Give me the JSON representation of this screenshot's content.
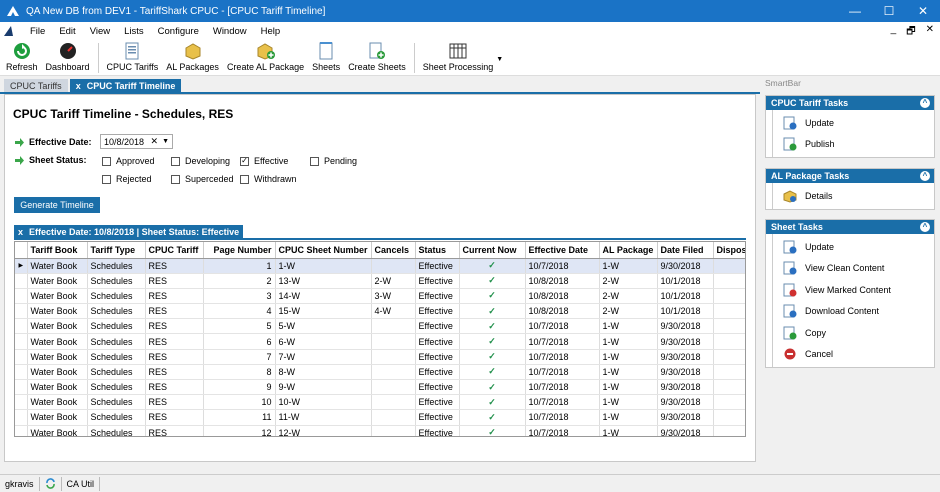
{
  "window": {
    "title": "QA New DB from DEV1 - TariffShark CPUC - [CPUC Tariff Timeline]",
    "controls": {
      "minimize": "—",
      "maximize": "☐",
      "close": "✕"
    },
    "mdi_controls": {
      "minimize": "_",
      "restore": "🗗",
      "close": "✕"
    }
  },
  "menu": [
    "File",
    "Edit",
    "View",
    "Lists",
    "Configure",
    "Window",
    "Help"
  ],
  "toolbar": {
    "refresh": "Refresh",
    "dashboard": "Dashboard",
    "cpuc_tariffs": "CPUC Tariffs",
    "al_packages": "AL Packages",
    "create_al_package": "Create AL Package",
    "sheets": "Sheets",
    "create_sheets": "Create Sheets",
    "sheet_processing": "Sheet Processing"
  },
  "tabs": [
    {
      "label": "CPUC Tariffs",
      "active": false
    },
    {
      "label": "CPUC Tariff Timeline",
      "active": true,
      "close": "x"
    }
  ],
  "main": {
    "title": "CPUC Tariff Timeline - Schedules, RES",
    "effective_date_label": "Effective Date:",
    "effective_date_value": "10/8/2018",
    "sheet_status_label": "Sheet Status:",
    "statuses": [
      {
        "label": "Approved",
        "checked": false
      },
      {
        "label": "Developing",
        "checked": false
      },
      {
        "label": "Effective",
        "checked": true
      },
      {
        "label": "Pending",
        "checked": false
      },
      {
        "label": "Rejected",
        "checked": false
      },
      {
        "label": "Superceded",
        "checked": false
      },
      {
        "label": "Withdrawn",
        "checked": false
      }
    ],
    "generate_button": "Generate Timeline",
    "grid_caption": "Effective Date: 10/8/2018 | Sheet Status: Effective",
    "grid_caption_close": "x",
    "check_mark": "✓",
    "row_indicator": "▶"
  },
  "grid": {
    "columns": [
      "Tariff Book",
      "Tariff Type",
      "CPUC Tariff",
      "Page Number",
      "CPUC Sheet Number",
      "Cancels",
      "Status",
      "Current Now",
      "Effective Date",
      "AL Package",
      "Date Filed",
      "Disposi"
    ],
    "rows": [
      [
        "Water Book",
        "Schedules",
        "RES",
        "1",
        "1-W",
        "",
        "Effective",
        "✓",
        "10/7/2018",
        "1-W",
        "9/30/2018",
        ""
      ],
      [
        "Water Book",
        "Schedules",
        "RES",
        "2",
        "13-W",
        "2-W",
        "Effective",
        "✓",
        "10/8/2018",
        "2-W",
        "10/1/2018",
        ""
      ],
      [
        "Water Book",
        "Schedules",
        "RES",
        "3",
        "14-W",
        "3-W",
        "Effective",
        "✓",
        "10/8/2018",
        "2-W",
        "10/1/2018",
        ""
      ],
      [
        "Water Book",
        "Schedules",
        "RES",
        "4",
        "15-W",
        "4-W",
        "Effective",
        "✓",
        "10/8/2018",
        "2-W",
        "10/1/2018",
        ""
      ],
      [
        "Water Book",
        "Schedules",
        "RES",
        "5",
        "5-W",
        "",
        "Effective",
        "✓",
        "10/7/2018",
        "1-W",
        "9/30/2018",
        ""
      ],
      [
        "Water Book",
        "Schedules",
        "RES",
        "6",
        "6-W",
        "",
        "Effective",
        "✓",
        "10/7/2018",
        "1-W",
        "9/30/2018",
        ""
      ],
      [
        "Water Book",
        "Schedules",
        "RES",
        "7",
        "7-W",
        "",
        "Effective",
        "✓",
        "10/7/2018",
        "1-W",
        "9/30/2018",
        ""
      ],
      [
        "Water Book",
        "Schedules",
        "RES",
        "8",
        "8-W",
        "",
        "Effective",
        "✓",
        "10/7/2018",
        "1-W",
        "9/30/2018",
        ""
      ],
      [
        "Water Book",
        "Schedules",
        "RES",
        "9",
        "9-W",
        "",
        "Effective",
        "✓",
        "10/7/2018",
        "1-W",
        "9/30/2018",
        ""
      ],
      [
        "Water Book",
        "Schedules",
        "RES",
        "10",
        "10-W",
        "",
        "Effective",
        "✓",
        "10/7/2018",
        "1-W",
        "9/30/2018",
        ""
      ],
      [
        "Water Book",
        "Schedules",
        "RES",
        "11",
        "11-W",
        "",
        "Effective",
        "✓",
        "10/7/2018",
        "1-W",
        "9/30/2018",
        ""
      ],
      [
        "Water Book",
        "Schedules",
        "RES",
        "12",
        "12-W",
        "",
        "Effective",
        "✓",
        "10/7/2018",
        "1-W",
        "9/30/2018",
        ""
      ]
    ]
  },
  "smartbar": {
    "title": "SmartBar",
    "collapse_glyph": "^",
    "panels": [
      {
        "title": "CPUC Tariff Tasks",
        "items": [
          {
            "label": "Update",
            "icon": "update-icon"
          },
          {
            "label": "Publish",
            "icon": "publish-icon"
          }
        ]
      },
      {
        "title": "AL Package Tasks",
        "items": [
          {
            "label": "Details",
            "icon": "details-icon"
          }
        ]
      },
      {
        "title": "Sheet Tasks",
        "items": [
          {
            "label": "Update",
            "icon": "update-icon"
          },
          {
            "label": "View Clean Content",
            "icon": "view-clean-icon"
          },
          {
            "label": "View Marked Content",
            "icon": "view-marked-icon"
          },
          {
            "label": "Download Content",
            "icon": "download-icon"
          },
          {
            "label": "Copy",
            "icon": "copy-icon"
          },
          {
            "label": "Cancel",
            "icon": "cancel-icon"
          }
        ]
      }
    ]
  },
  "status": {
    "user": "gkravis",
    "module": "CA Util"
  },
  "colors": {
    "accent": "#1a6ea8",
    "titlebar": "#1a73c6",
    "check": "#1f8f4a"
  }
}
